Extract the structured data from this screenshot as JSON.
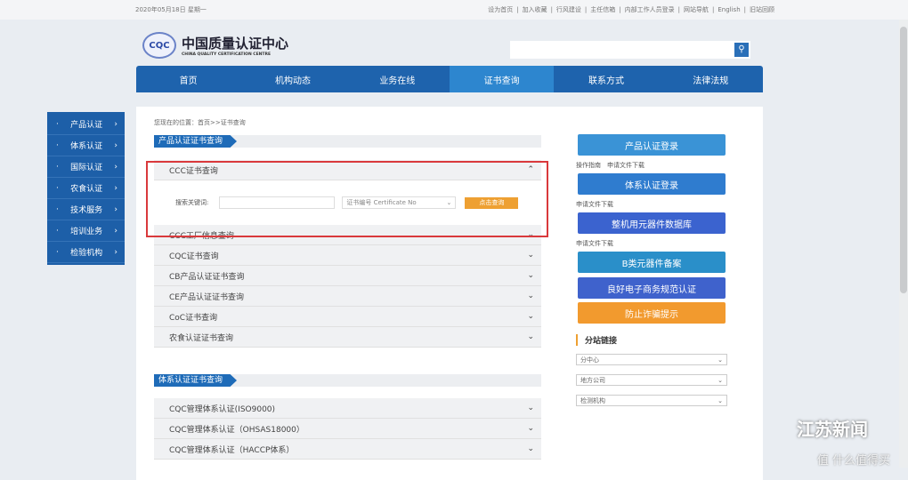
{
  "topbar": {
    "date": "2020年05月18日 星期一",
    "links": [
      "设为首页",
      "加入收藏",
      "行风建设",
      "主任信箱",
      "内部工作人员登录",
      "网站导航",
      "English",
      "旧站回顾"
    ]
  },
  "logo": {
    "mark": "CQC",
    "cn": "中国质量认证中心",
    "en": "CHINA QUALITY CERTIFICATION CENTRE"
  },
  "nav": [
    {
      "label": "首页"
    },
    {
      "label": "机构动态"
    },
    {
      "label": "业务在线"
    },
    {
      "label": "证书查询",
      "active": true
    },
    {
      "label": "联系方式"
    },
    {
      "label": "法律法规"
    }
  ],
  "sidebar": [
    "产品认证",
    "体系认证",
    "国际认证",
    "农食认证",
    "技术服务",
    "培训业务",
    "检验机构"
  ],
  "breadcrumb": "您现在的位置：首页>>证书查询",
  "section1": {
    "title": "产品认证证书查询",
    "open": {
      "title": "CCC证书查询",
      "keyword_label": "搜索关键词:",
      "keyword_value": "",
      "select_value": "证书编号 Certificate No",
      "button": "点击查询"
    },
    "items": [
      "CCC工厂信息查询",
      "CQC证书查询",
      "CB产品认证证书查询",
      "CE产品认证证书查询",
      "CoC证书查询",
      "农食认证证书查询"
    ]
  },
  "section2": {
    "title": "体系认证证书查询",
    "items": [
      "CQC管理体系认证(ISO9000)",
      "CQC管理体系认证（OHSAS18000）",
      "CQC管理体系认证（HACCP体系）"
    ]
  },
  "right": {
    "buttons": [
      "产品认证登录",
      "体系认证登录",
      "整机用元器件数据库",
      "B类元器件备案",
      "良好电子商务规范认证",
      "防止诈骗提示"
    ],
    "links1": "操作指南　申请文件下载",
    "links2": "申请文件下载",
    "links3": "申请文件下载",
    "branch_title": "分站链接",
    "selects": [
      "分中心",
      "地方公司",
      "检测机构"
    ]
  },
  "watermark": {
    "text": "江苏新闻",
    "sub": "值 什么值得买"
  },
  "colors": {
    "nav": "#1e63ad",
    "highlight": "#d9393c",
    "query_button": "#eea032"
  }
}
